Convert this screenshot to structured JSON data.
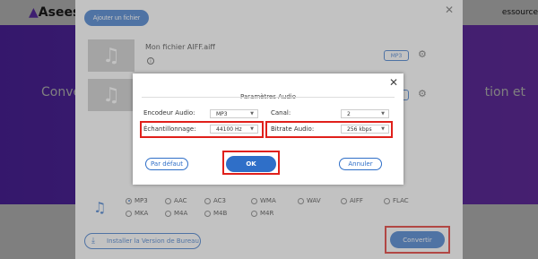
{
  "site": {
    "logo": "Asees",
    "nav_item": "essource",
    "left_text": "Conve",
    "right_text": "tion et"
  },
  "panel": {
    "add_file_label": "Ajouter un fichier",
    "files": [
      {
        "name": "Mon fichier AIFF.aiff",
        "format": "MP3"
      },
      {
        "name": "",
        "format": "MP3"
      }
    ],
    "install_label": "Installer la Version de Bureau",
    "convert_label": "Convertir",
    "format_options": [
      {
        "label": "MP3",
        "selected": true
      },
      {
        "label": "AAC",
        "selected": false
      },
      {
        "label": "AC3",
        "selected": false
      },
      {
        "label": "WMA",
        "selected": false
      },
      {
        "label": "WAV",
        "selected": false
      },
      {
        "label": "AIFF",
        "selected": false
      },
      {
        "label": "FLAC",
        "selected": false
      },
      {
        "label": "MKA",
        "selected": false
      },
      {
        "label": "M4A",
        "selected": false
      },
      {
        "label": "M4B",
        "selected": false
      },
      {
        "label": "M4R",
        "selected": false
      }
    ]
  },
  "dialog": {
    "title": "Paramètres Audio",
    "encoder_label": "Encodeur Audio:",
    "encoder_value": "MP3",
    "channel_label": "Canal:",
    "channel_value": "2",
    "sample_rate_label": "Échantillonnage:",
    "sample_rate_value": "44100 Hz",
    "bitrate_label": "Bitrate Audio:",
    "bitrate_value": "256 kbps",
    "default_label": "Par défaut",
    "ok_label": "OK",
    "cancel_label": "Annuler"
  },
  "colors": {
    "accent": "#2f6fc8",
    "highlight": "#e0201b",
    "purple": "#7a3ce0"
  }
}
